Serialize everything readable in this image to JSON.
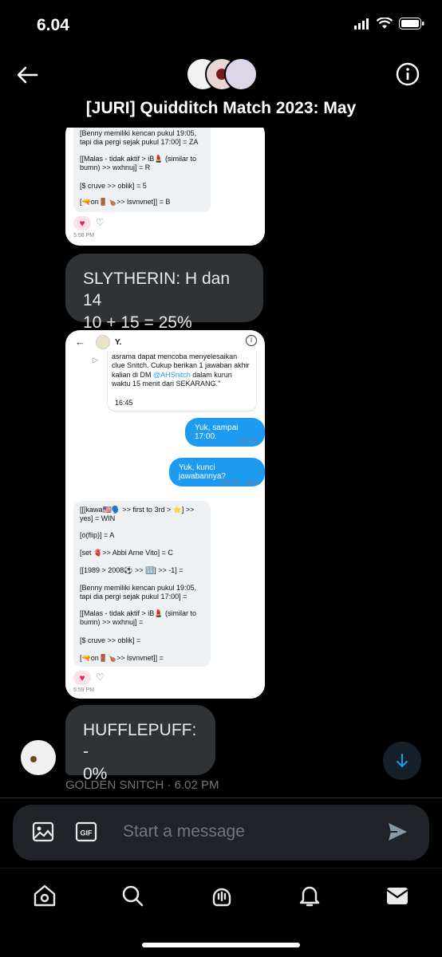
{
  "status_bar": {
    "time": "6.04"
  },
  "header": {
    "title": "[JURI] Quidditch Match 2023: May"
  },
  "messages": {
    "card1": {
      "lines": [
        "[Benny memiliki kencan pukul 19:05, tapi dia pergi sejak pukul 17:00] = ZA",
        "[[Malas - tidak aktif > iB💄 (similar to bumn) >> wxhnuj] = R",
        "[$ cruve >> oblik] = 5",
        "[🔫on🚪🍗>> lsvnvnet]] = B"
      ],
      "time": "5:58 PM"
    },
    "bubble1": {
      "line1": "SLYTHERIN: H dan 14",
      "line2": "10 + 15 = 25%"
    },
    "card2": {
      "header_name": "Y.",
      "quoted": "asrama dapat mencoba menyelesaikan clue Snitch. Cukup berikan 1 jawaban akhir kalian di DM",
      "quoted_handle": "@AHSnitch",
      "quoted_end": "dalam kurun waktu 15 menit dari SEKARANG.\"",
      "quoted_time": "16:45",
      "out1": "Yuk, sampai 17:00.",
      "out1_time": "5:45 PM",
      "out2": "Yuk, kunci jawabannya?",
      "out2_time": "5:58 PM · Dilihat",
      "clues": [
        "[[[kawa🇺🇸🗣️ >> first to 3rd > ⭐] >> yes] = WIN",
        "[o(flip)] = A",
        "[set 🫀>> Abbi Arne Vito] = C",
        "[[1989 > 2008⚽ >> 🔢] >> -1] =",
        "[Benny memiliki kencan pukul 19:05, tapi dia pergi sejak pukul 17:00] =",
        "[[Malas - tidak aktif > iB💄 (similar to bumn) >> wxhnuj] =",
        "[$ cruve >> oblik] =",
        "[🔫on🚪🍗>> lsvnvnet]] ="
      ],
      "time": "5:59 PM"
    },
    "bubble2": {
      "line1": "HUFFLEPUFF: -",
      "line2": "0%"
    },
    "meta": "GOLDEN SNITCH · 6.02 PM"
  },
  "composer": {
    "placeholder": "Start a message"
  },
  "colors": {
    "accent": "#1d9bf0",
    "bubble": "#2f3336",
    "background": "#000000"
  }
}
